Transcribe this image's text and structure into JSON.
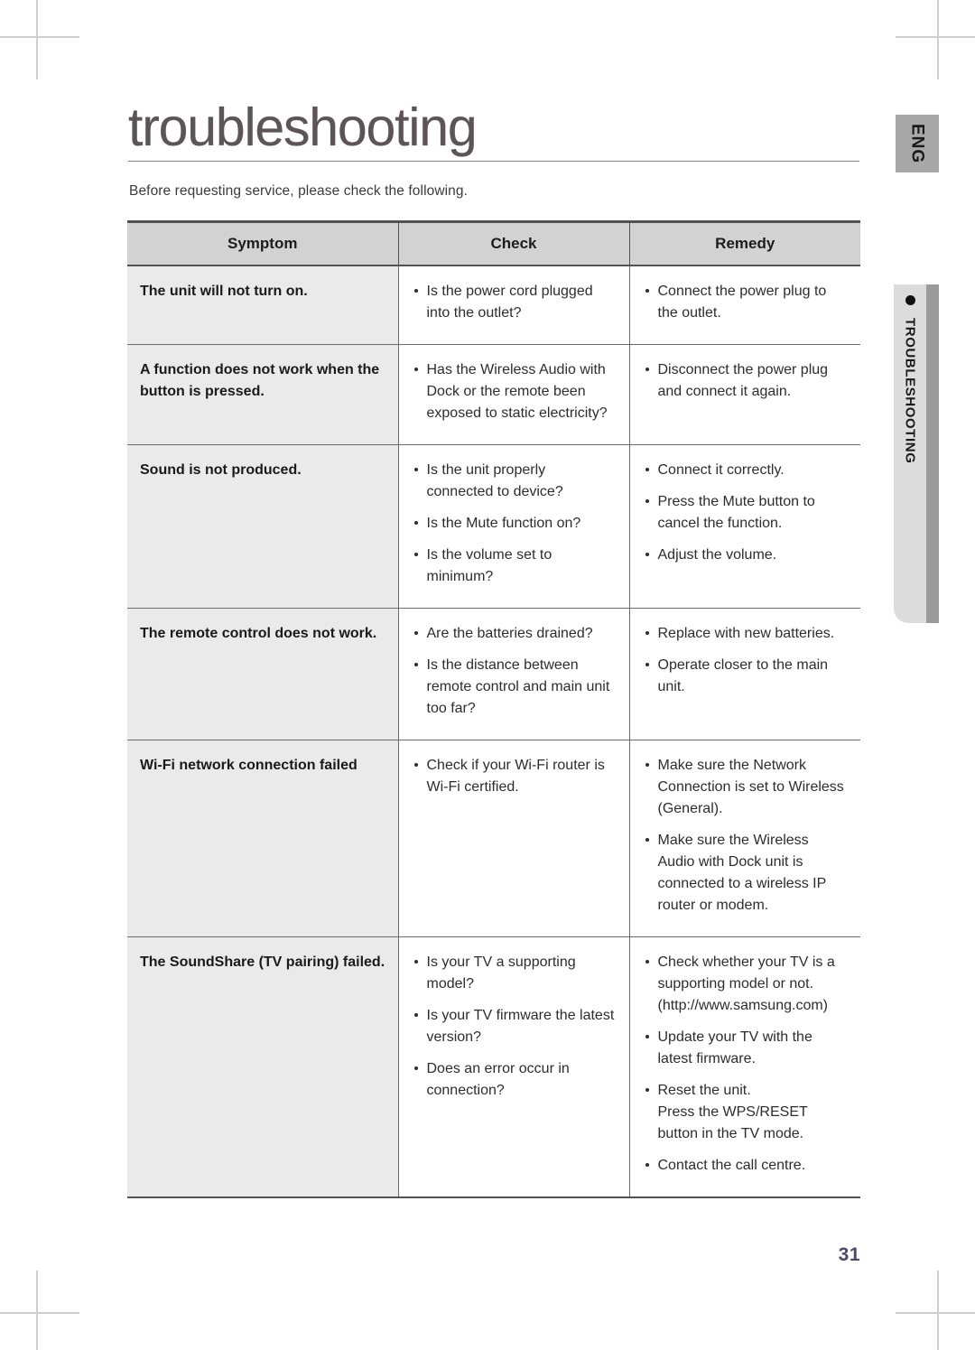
{
  "document": {
    "title": "troubleshooting",
    "intro": "Before requesting service, please check the following.",
    "page_number": "31"
  },
  "side_tabs": {
    "language_badge": "ENG",
    "section_label": "TROUBLESHOOTING",
    "bullet_icon": "filled-circle-icon"
  },
  "colors": {
    "title_text": "#5d5458",
    "table_header_bg": "#d2d2d2",
    "symptom_cell_bg": "#eaeaea",
    "tab_face": "#dcdcdc",
    "tab_shadow": "#9b9b9b",
    "language_badge_bg": "#a8a8a8",
    "folio_text": "#4b4a66"
  },
  "table": {
    "headers": [
      "Symptom",
      "Check",
      "Remedy"
    ],
    "rows": [
      {
        "symptom": "The unit will not turn on.",
        "check": [
          "Is the power cord plugged into the outlet?"
        ],
        "remedy": [
          "Connect the power plug to the outlet."
        ]
      },
      {
        "symptom": "A function does not work when the button is pressed.",
        "check": [
          "Has the Wireless Audio with Dock or the remote been exposed to static electricity?"
        ],
        "remedy": [
          "Disconnect the power plug and connect it again."
        ]
      },
      {
        "symptom": "Sound is not produced.",
        "check": [
          "Is the unit properly connected to device?",
          "Is the Mute function on?",
          "Is the volume set to minimum?"
        ],
        "remedy": [
          "Connect it correctly.",
          "Press the Mute button to cancel the function.",
          "Adjust the volume."
        ]
      },
      {
        "symptom": "The remote control does not work.",
        "check": [
          "Are the batteries drained?",
          "Is the distance between remote control and main unit too far?"
        ],
        "remedy": [
          "Replace with new batteries.",
          "Operate closer to the main unit."
        ]
      },
      {
        "symptom": "Wi-Fi network connection failed",
        "check": [
          "Check if your Wi-Fi router is Wi-Fi certified."
        ],
        "remedy": [
          "Make sure the Network Connection is set to Wireless (General).",
          "Make sure the Wireless Audio with Dock unit is connected to a wireless IP router or modem."
        ]
      },
      {
        "symptom": "The SoundShare (TV pairing) failed.",
        "check": [
          "Is your TV a supporting model?",
          "Is your TV firmware the latest version?",
          "Does an error occur in connection?"
        ],
        "remedy": [
          "Check whether your TV is a supporting model or not. (http://www.samsung.com)",
          "Update your TV with the latest firmware.",
          "Reset the unit.\nPress the WPS/RESET button in the TV mode.",
          "Contact the call centre."
        ]
      }
    ]
  }
}
